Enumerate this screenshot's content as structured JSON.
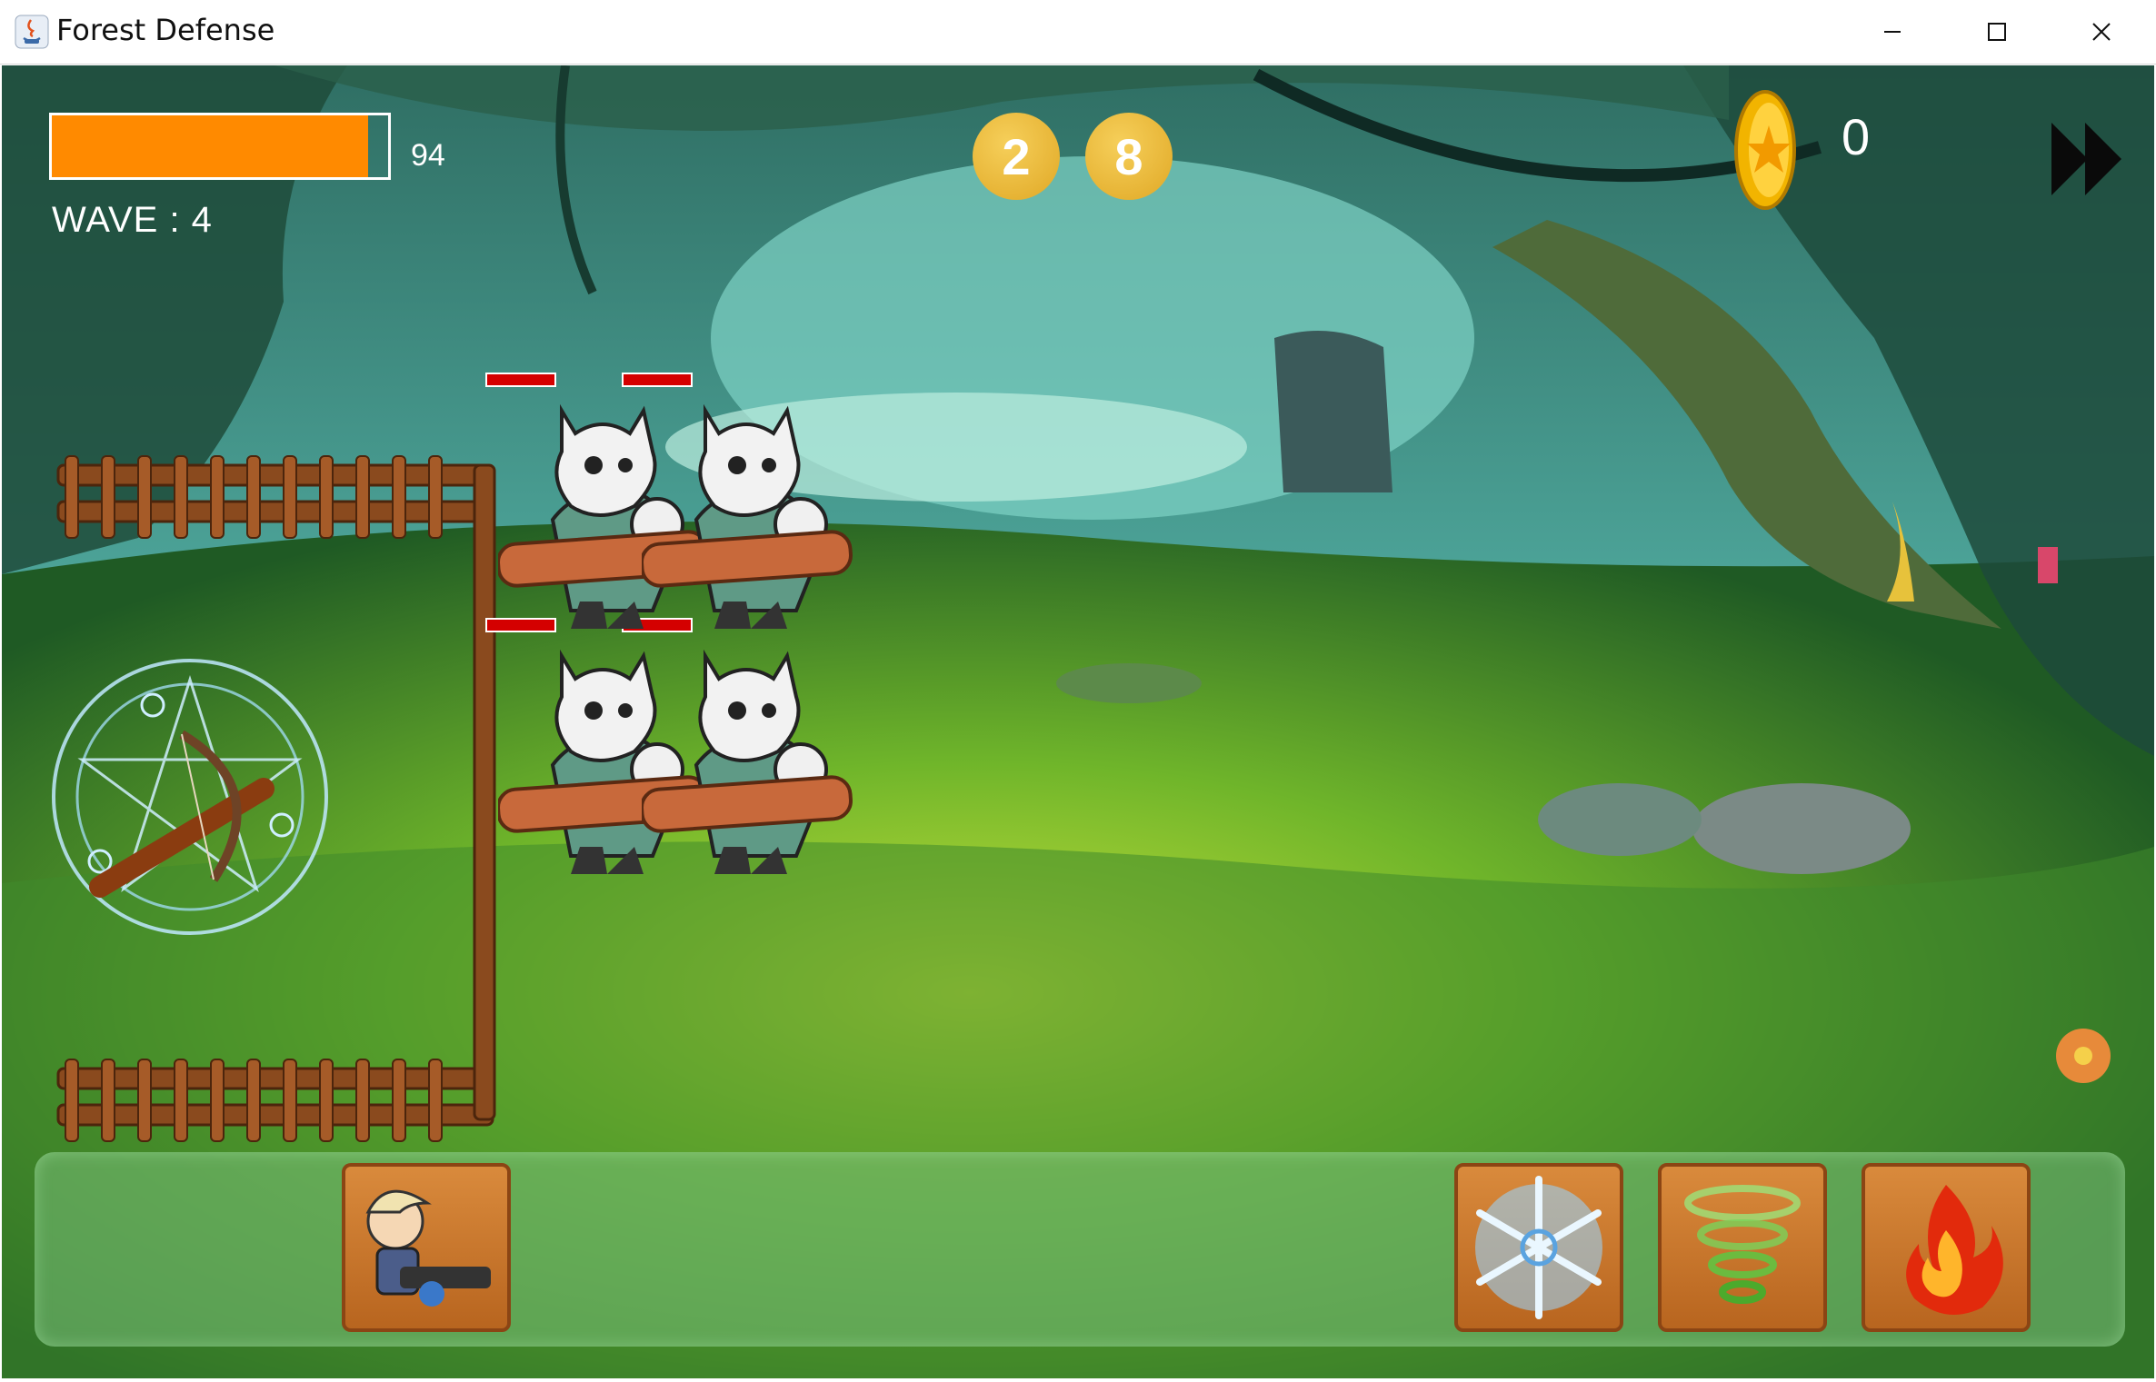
{
  "window": {
    "title": "Forest Defense"
  },
  "hud": {
    "base_health": {
      "value": 94,
      "max": 100,
      "display": "94",
      "fill_fraction": 0.94,
      "color": "#ff8a00"
    },
    "wave_label": "WAVE : 4",
    "counters": [
      "2",
      "8"
    ],
    "gold": "0"
  },
  "enemies": {
    "count": 4,
    "type": "skull-helmet orc with spiked club"
  },
  "toolbar": {
    "cards": [
      {
        "name": "gunner-hero",
        "kind": "unit"
      },
      {
        "name": "ice-spell",
        "kind": "spell"
      },
      {
        "name": "wind-spell",
        "kind": "spell"
      },
      {
        "name": "fire-spell",
        "kind": "spell"
      }
    ]
  },
  "colors": {
    "health_fill": "#ff8a00",
    "enemy_health": "#d40000",
    "coin": "#f2b400",
    "card": "#c9772c"
  }
}
